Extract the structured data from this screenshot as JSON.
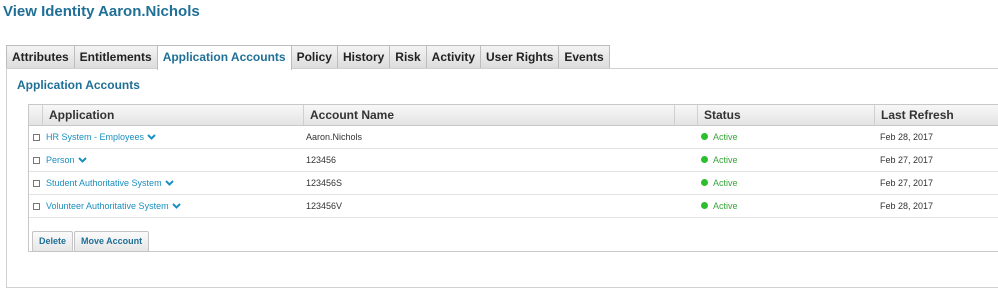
{
  "page": {
    "title": "View Identity Aaron.Nichols"
  },
  "tabs": [
    {
      "label": "Attributes",
      "active": false
    },
    {
      "label": "Entitlements",
      "active": false
    },
    {
      "label": "Application Accounts",
      "active": true
    },
    {
      "label": "Policy",
      "active": false
    },
    {
      "label": "History",
      "active": false
    },
    {
      "label": "Risk",
      "active": false
    },
    {
      "label": "Activity",
      "active": false
    },
    {
      "label": "User Rights",
      "active": false
    },
    {
      "label": "Events",
      "active": false
    }
  ],
  "section": {
    "title": "Application Accounts"
  },
  "table": {
    "columns": [
      "Application",
      "Account Name",
      "Status",
      "Last Refresh"
    ],
    "rows": [
      {
        "application": "HR System - Employees",
        "account_name": "Aaron.Nichols",
        "status": "Active",
        "last_refresh": "Feb 28, 2017"
      },
      {
        "application": "Person",
        "account_name": "123456",
        "status": "Active",
        "last_refresh": "Feb 27, 2017"
      },
      {
        "application": "Student Authoritative System",
        "account_name": "123456S",
        "status": "Active",
        "last_refresh": "Feb 27, 2017"
      },
      {
        "application": "Volunteer Authoritative System",
        "account_name": "123456V",
        "status": "Active",
        "last_refresh": "Feb 28, 2017"
      }
    ]
  },
  "buttons": {
    "delete": "Delete",
    "move_account": "Move Account"
  },
  "colors": {
    "accent": "#1f6f96",
    "link": "#1a8fc0",
    "status_active": "#2dbe2d"
  },
  "icons": {
    "expand": "chevron-down-icon"
  }
}
